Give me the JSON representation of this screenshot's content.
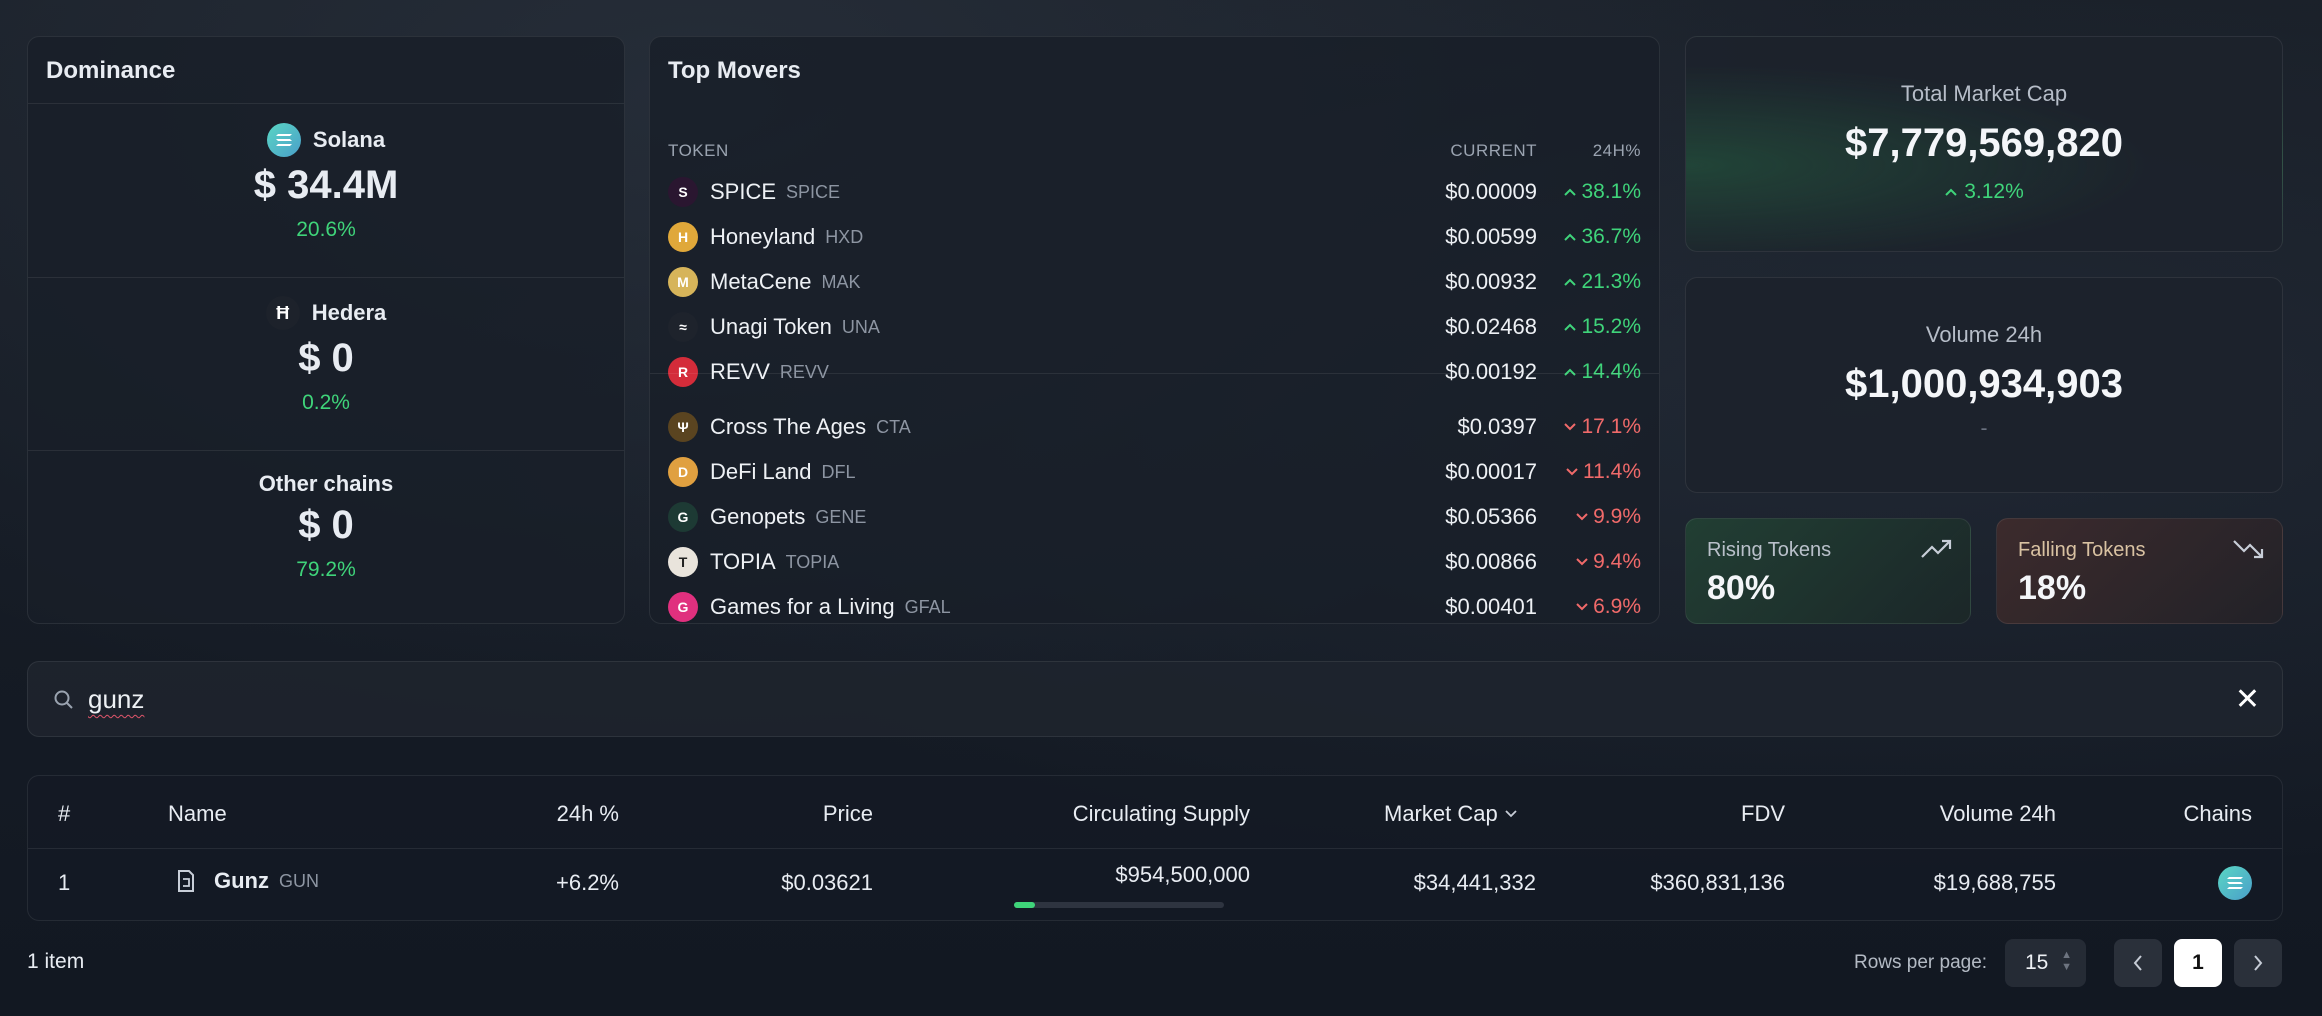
{
  "dominance": {
    "title": "Dominance",
    "items": [
      {
        "name": "Solana",
        "amount": "$ 34.4M",
        "pct": "20.6%",
        "icon": "solana-icon"
      },
      {
        "name": "Hedera",
        "amount": "$ 0",
        "pct": "0.2%",
        "icon": "hedera-icon"
      },
      {
        "name": "Other chains",
        "amount": "$ 0",
        "pct": "79.2%"
      }
    ]
  },
  "movers": {
    "title": "Top Movers",
    "col_token": "TOKEN",
    "col_current": "CURRENT",
    "col_change": "24H%",
    "gainers": [
      {
        "name": "SPICE",
        "symbol": "SPICE",
        "price": "$0.00009",
        "change": "38.1%",
        "icon_color": "#2a1630",
        "icon_text": "S"
      },
      {
        "name": "Honeyland",
        "symbol": "HXD",
        "price": "$0.00599",
        "change": "36.7%",
        "icon_color": "#e0a83a",
        "icon_text": "H"
      },
      {
        "name": "MetaCene",
        "symbol": "MAK",
        "price": "$0.00932",
        "change": "21.3%",
        "icon_color": "#d6b45a",
        "icon_text": "M"
      },
      {
        "name": "Unagi Token",
        "symbol": "UNA",
        "price": "$0.02468",
        "change": "15.2%",
        "icon_color": "#1e232c",
        "icon_text": "≈"
      },
      {
        "name": "REVV",
        "symbol": "REVV",
        "price": "$0.00192",
        "change": "14.4%",
        "icon_color": "#d42c3a",
        "icon_text": "R"
      }
    ],
    "losers": [
      {
        "name": "Cross The Ages",
        "symbol": "CTA",
        "price": "$0.0397",
        "change": "17.1%",
        "icon_color": "#5a4420",
        "icon_text": "Ψ"
      },
      {
        "name": "DeFi Land",
        "symbol": "DFL",
        "price": "$0.00017",
        "change": "11.4%",
        "icon_color": "#e0a040",
        "icon_text": "D"
      },
      {
        "name": "Genopets",
        "symbol": "GENE",
        "price": "$0.05366",
        "change": "9.9%",
        "icon_color": "#1d3a34",
        "icon_text": "G"
      },
      {
        "name": "TOPIA",
        "symbol": "TOPIA",
        "price": "$0.00866",
        "change": "9.4%",
        "icon_color": "#e9e4dc",
        "icon_text": "T"
      },
      {
        "name": "Games for a Living",
        "symbol": "GFAL",
        "price": "$0.00401",
        "change": "6.9%",
        "icon_color": "#e0307e",
        "icon_text": "G"
      }
    ]
  },
  "stats": {
    "total_cap_label": "Total Market Cap",
    "total_cap_value": "$7,779,569,820",
    "total_cap_change": "3.12%",
    "volume_label": "Volume 24h",
    "volume_value": "$1,000,934,903",
    "volume_change": "-",
    "rising_label": "Rising Tokens",
    "rising_value": "80%",
    "falling_label": "Falling Tokens",
    "falling_value": "18%"
  },
  "search": {
    "value": "gunz"
  },
  "table": {
    "headers": [
      "#",
      "Name",
      "24h %",
      "Price",
      "Circulating Supply",
      "Market Cap",
      "FDV",
      "Volume 24h",
      "Chains"
    ],
    "rows": [
      {
        "rank": "1",
        "name": "Gunz",
        "symbol": "GUN",
        "change": "+6.2%",
        "price": "$0.03621",
        "supply": "$954,500,000",
        "supply_fraction": 0.1,
        "market_cap": "$34,441,332",
        "fdv": "$360,831,136",
        "volume": "$19,688,755",
        "chain_icon": "solana-icon"
      }
    ]
  },
  "footer": {
    "item_count": "1 item",
    "rows_label": "Rows per page:",
    "rows_value": "15",
    "page": "1"
  },
  "colors": {
    "up": "#3fd47a",
    "down": "#f06a6a",
    "accent": "#3fd47a"
  }
}
